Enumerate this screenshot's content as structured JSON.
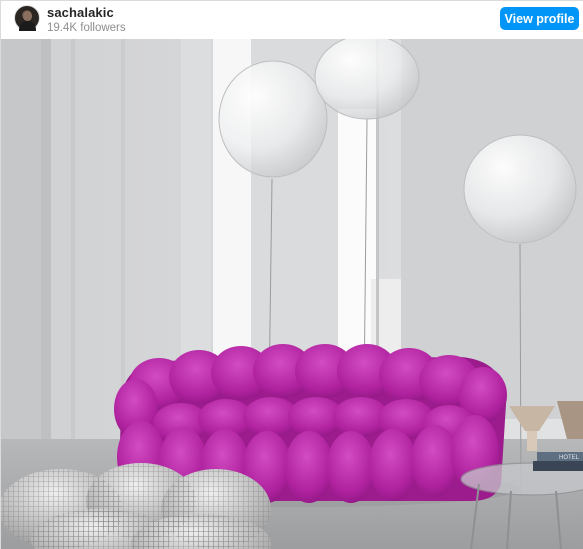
{
  "profile": {
    "username": "sachalakic",
    "followers": "19.4K followers",
    "view_profile_label": "View profile"
  },
  "post": {
    "subject": "magenta-bubble-sofa-with-balloons",
    "colors": {
      "sofa": "#b0229f",
      "wall": "#d6d7d9",
      "floor": "#a9aaac",
      "button": "#0095f6"
    },
    "book_label": "HOTEL"
  }
}
